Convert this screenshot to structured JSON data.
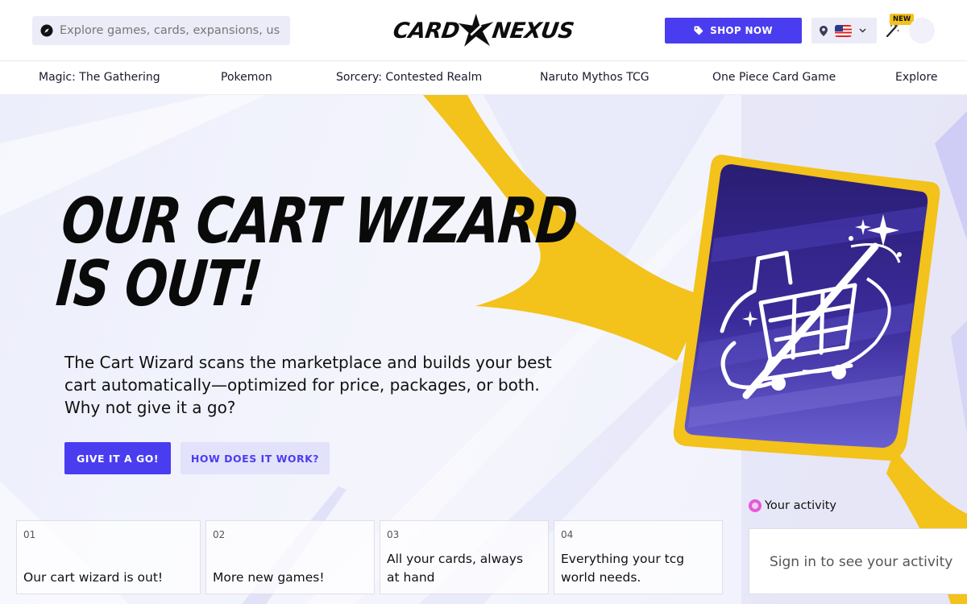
{
  "header": {
    "search": {
      "placeholder": "Explore games, cards, expansions, users",
      "icon": "compass-icon"
    },
    "logo": {
      "left_word": "CARD",
      "right_word": "NEXUS"
    },
    "shop_button": {
      "label": "SHOP NOW",
      "icon": "tag-icon"
    },
    "locale": {
      "icons": [
        "location-pin-icon",
        "us-flag-icon",
        "chevron-down-icon"
      ]
    },
    "new_badge": "NEW",
    "wand_icon": "magic-wand-icon"
  },
  "nav": {
    "items": [
      {
        "label": "Magic: The Gathering"
      },
      {
        "label": "Pokemon"
      },
      {
        "label": "Sorcery: Contested Realm"
      },
      {
        "label": "Naruto Mythos TCG"
      },
      {
        "label": "One Piece Card Game"
      },
      {
        "label": "Explore"
      }
    ]
  },
  "hero": {
    "headline_line1": "OUR CART WIZARD",
    "headline_line2": "IS OUT!",
    "subtext": "The Cart Wizard scans the marketplace and builds your best cart automatically—optimized for price, packages, or both. Why not give it a go?",
    "primary_button": "GIVE IT A GO!",
    "secondary_button": "HOW DOES IT WORK?"
  },
  "news": {
    "tiles": [
      {
        "num": "01",
        "title": "Our cart wizard is out!"
      },
      {
        "num": "02",
        "title": "More new games!"
      },
      {
        "num": "03",
        "title": "All your cards, always at hand"
      },
      {
        "num": "04",
        "title": "Everything your tcg world needs."
      }
    ]
  },
  "activity": {
    "label": "Your activity",
    "message": "Sign in to see your activity"
  },
  "colors": {
    "brand_purple": "#4a3df0",
    "accent_yellow": "#f3c21b",
    "hero_bg": "#eceefb",
    "card_dark": "#2b1f7a"
  }
}
